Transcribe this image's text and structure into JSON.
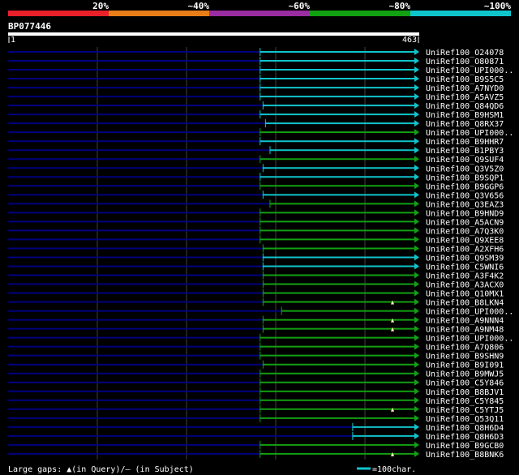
{
  "identity_scale": {
    "labels": [
      "20%",
      "~40%",
      "~60%",
      "~80%",
      "~100%"
    ],
    "colors": [
      "#e8202a",
      "#e87e18",
      "#9a2da2",
      "#12a012",
      "#10c4cc"
    ]
  },
  "query": {
    "name": "BP077446",
    "start": "1",
    "end": "463"
  },
  "colors": {
    "background": "#000000",
    "query_bar": "#ffffff",
    "unaligned_line": "#000080",
    "grid": "#404040",
    "cyan_hit": "#10c4cc",
    "green_hit": "#12a012",
    "gap_marker": "#ffffa0"
  },
  "hits": [
    {
      "name": "UniRef100_O24078",
      "color": "cyan",
      "start_frac": 0.613
    },
    {
      "name": "UniRef100_O80871",
      "color": "cyan",
      "start_frac": 0.613
    },
    {
      "name": "UniRef100_UPI000..",
      "color": "cyan",
      "start_frac": 0.613
    },
    {
      "name": "UniRef100_B9S5C5",
      "color": "cyan",
      "start_frac": 0.613
    },
    {
      "name": "UniRef100_A7NYD0",
      "color": "cyan",
      "start_frac": 0.613
    },
    {
      "name": "UniRef100_A5AVZ5",
      "color": "cyan",
      "start_frac": 0.613
    },
    {
      "name": "UniRef100_Q84QD6",
      "color": "cyan",
      "start_frac": 0.62
    },
    {
      "name": "UniRef100_B9HSM1",
      "color": "cyan",
      "start_frac": 0.613
    },
    {
      "name": "UniRef100_Q8RX37",
      "color": "cyan",
      "start_frac": 0.626
    },
    {
      "name": "UniRef100_UPI000..",
      "color": "green",
      "start_frac": 0.613
    },
    {
      "name": "UniRef100_B9HHR7",
      "color": "cyan",
      "start_frac": 0.613
    },
    {
      "name": "UniRef100_B1PBY3",
      "color": "cyan",
      "start_frac": 0.637
    },
    {
      "name": "UniRef100_Q9SUF4",
      "color": "green",
      "start_frac": 0.613
    },
    {
      "name": "UniRef100_Q3V5Z0",
      "color": "cyan",
      "start_frac": 0.62
    },
    {
      "name": "UniRef100_B9SQP1",
      "color": "cyan",
      "start_frac": 0.613
    },
    {
      "name": "UniRef100_B9GGP6",
      "color": "green",
      "start_frac": 0.613
    },
    {
      "name": "UniRef100_Q3V656",
      "color": "cyan",
      "start_frac": 0.62
    },
    {
      "name": "UniRef100_Q3EAZ3",
      "color": "green",
      "start_frac": 0.637
    },
    {
      "name": "UniRef100_B9HND9",
      "color": "green",
      "start_frac": 0.613
    },
    {
      "name": "UniRef100_A5ACN9",
      "color": "green",
      "start_frac": 0.613
    },
    {
      "name": "UniRef100_A7Q3K0",
      "color": "green",
      "start_frac": 0.613
    },
    {
      "name": "UniRef100_Q9XEE8",
      "color": "green",
      "start_frac": 0.613
    },
    {
      "name": "UniRef100_A2XFH6",
      "color": "green",
      "start_frac": 0.62
    },
    {
      "name": "UniRef100_Q9SM39",
      "color": "cyan",
      "start_frac": 0.62
    },
    {
      "name": "UniRef100_C5WNI6",
      "color": "cyan",
      "start_frac": 0.62
    },
    {
      "name": "UniRef100_A3F4K2",
      "color": "green",
      "start_frac": 0.62
    },
    {
      "name": "UniRef100_A3ACX0",
      "color": "green",
      "start_frac": 0.62
    },
    {
      "name": "UniRef100_Q10MX1",
      "color": "green",
      "start_frac": 0.62
    },
    {
      "name": "UniRef100_B8LKN4",
      "color": "green",
      "start_frac": 0.62
    },
    {
      "name": "UniRef100_UPI000..",
      "color": "green",
      "start_frac": 0.665
    },
    {
      "name": "UniRef100_A9NNN4",
      "color": "green",
      "start_frac": 0.62
    },
    {
      "name": "UniRef100_A9NM48",
      "color": "green",
      "start_frac": 0.62
    },
    {
      "name": "UniRef100_UPI000..",
      "color": "green",
      "start_frac": 0.613
    },
    {
      "name": "UniRef100_A7Q806",
      "color": "green",
      "start_frac": 0.613
    },
    {
      "name": "UniRef100_B9SHN9",
      "color": "green",
      "start_frac": 0.613
    },
    {
      "name": "UniRef100_B9I091",
      "color": "green",
      "start_frac": 0.62
    },
    {
      "name": "UniRef100_B9MWJ5",
      "color": "green",
      "start_frac": 0.613
    },
    {
      "name": "UniRef100_C5Y846",
      "color": "green",
      "start_frac": 0.613
    },
    {
      "name": "UniRef100_B8BJV1",
      "color": "green",
      "start_frac": 0.613
    },
    {
      "name": "UniRef100_C5Y845",
      "color": "green",
      "start_frac": 0.613
    },
    {
      "name": "UniRef100_C5YTJ5",
      "color": "green",
      "start_frac": 0.613
    },
    {
      "name": "UniRef100_Q53Q11",
      "color": "green",
      "start_frac": 0.613
    },
    {
      "name": "UniRef100_Q8H6D4",
      "color": "cyan",
      "start_frac": 0.838
    },
    {
      "name": "UniRef100_Q8H6D3",
      "color": "cyan",
      "start_frac": 0.838
    },
    {
      "name": "UniRef100_B9GCB0",
      "color": "green",
      "start_frac": 0.613
    },
    {
      "name": "UniRef100_B8BNK6",
      "color": "green",
      "start_frac": 0.613
    }
  ],
  "query_gap_hits": [
    28,
    30,
    31,
    40,
    45
  ],
  "footer": {
    "legend_text": "Large gaps: ▲(in Query)/— (in Subject)",
    "scale_text": "=100char."
  }
}
